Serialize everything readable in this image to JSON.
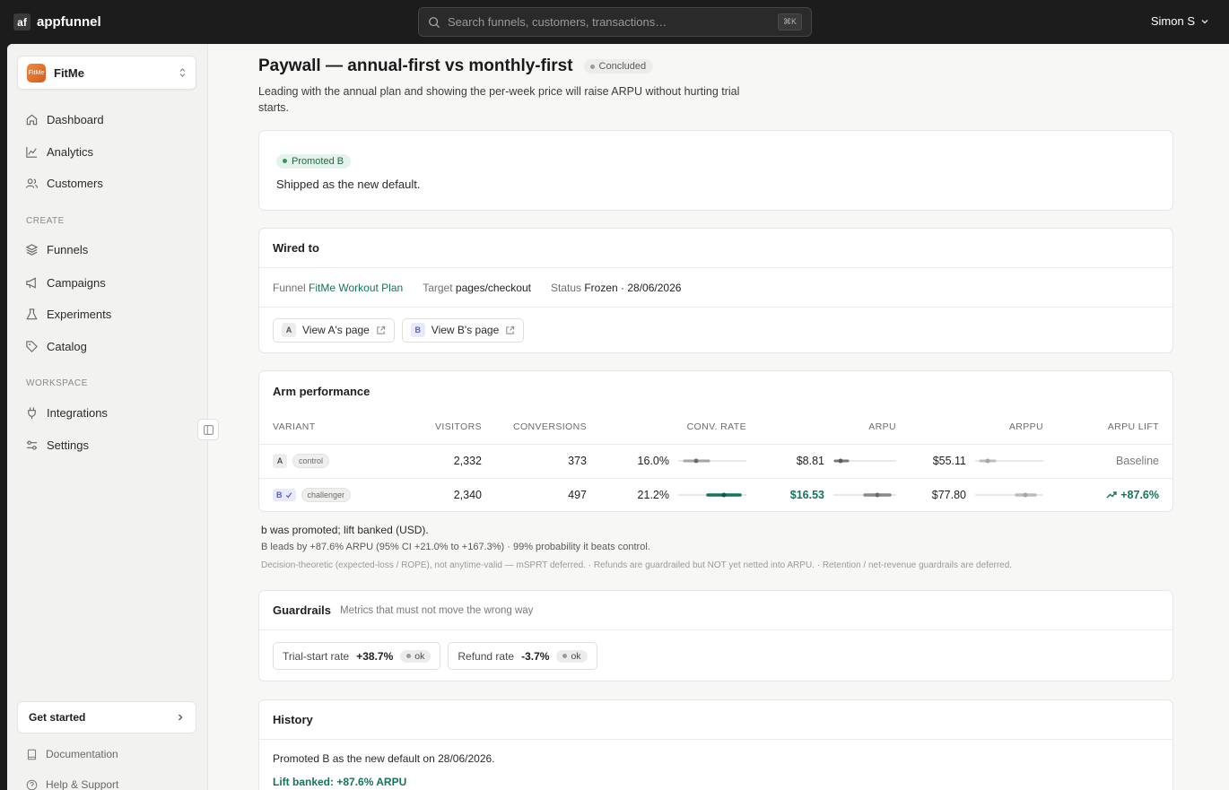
{
  "app": {
    "logo_mark": "af",
    "name": "appfunnel"
  },
  "search": {
    "placeholder": "Search funnels, customers, transactions…",
    "shortcut": "⌘K"
  },
  "user": {
    "name": "Simon S"
  },
  "workspace": {
    "avatar": "FitMe",
    "name": "FitMe"
  },
  "sidebar": {
    "items": [
      {
        "label": "Dashboard",
        "icon": "home-icon"
      },
      {
        "label": "Analytics",
        "icon": "chart-icon"
      },
      {
        "label": "Customers",
        "icon": "users-icon"
      }
    ],
    "create_label": "CREATE",
    "create_items": [
      {
        "label": "Funnels",
        "icon": "layers-icon"
      },
      {
        "label": "Campaigns",
        "icon": "megaphone-icon"
      },
      {
        "label": "Experiments",
        "icon": "flask-icon"
      },
      {
        "label": "Catalog",
        "icon": "tag-icon"
      }
    ],
    "workspace_label": "WORKSPACE",
    "workspace_items": [
      {
        "label": "Integrations",
        "icon": "plug-icon"
      },
      {
        "label": "Settings",
        "icon": "sliders-icon"
      }
    ],
    "get_started": "Get started",
    "documentation": "Documentation",
    "help": "Help & Support"
  },
  "experiment": {
    "title": "Paywall — annual-first vs monthly-first",
    "status": "Concluded",
    "hypothesis": "Leading with the annual plan and showing the per-week price will raise ARPU without hurting trial starts."
  },
  "decision": {
    "badge": "Promoted B",
    "text": "Shipped as the new default."
  },
  "wired": {
    "title": "Wired to",
    "funnel_label": "Funnel",
    "funnel_value": "FitMe Workout Plan",
    "target_label": "Target",
    "target_value": "pages/checkout",
    "status_label": "Status",
    "status_value": "Frozen · 28/06/2026",
    "view_a_chip": "A",
    "view_a": "View A's page",
    "view_b_chip": "B",
    "view_b": "View B's page"
  },
  "performance": {
    "title": "Arm performance",
    "headers": {
      "variant": "VARIANT",
      "visitors": "VISITORS",
      "conversions": "CONVERSIONS",
      "conv_rate": "CONV. RATE",
      "arpu": "ARPU",
      "arppu": "ARPPU",
      "arpu_lift": "ARPU LIFT"
    },
    "rows": [
      {
        "variant": "A",
        "tag": "control",
        "visitors": "2,332",
        "conversions": "373",
        "conv_rate": "16.0%",
        "arpu": "$8.81",
        "arppu": "$55.11",
        "lift": "Baseline"
      },
      {
        "variant": "B",
        "tag": "challenger",
        "visitors": "2,340",
        "conversions": "497",
        "conv_rate": "21.2%",
        "arpu": "$16.53",
        "arppu": "$77.80",
        "lift": "+87.6%"
      }
    ]
  },
  "notes": {
    "line1": "b was promoted; lift banked (USD).",
    "line2": "B leads by +87.6% ARPU (95% CI +21.0% to +167.3%) · 99% probability it beats control.",
    "line3": "Decision-theoretic (expected-loss / ROPE), not anytime-valid — mSPRT deferred. · Refunds are guardrailed but NOT yet netted into ARPU. · Retention / net-revenue guardrails are deferred."
  },
  "guardrails": {
    "title": "Guardrails",
    "subtitle": "Metrics that must not move the wrong way",
    "items": [
      {
        "label": "Trial-start rate",
        "value": "+38.7%",
        "status": "ok"
      },
      {
        "label": "Refund rate",
        "value": "-3.7%",
        "status": "ok"
      }
    ]
  },
  "history": {
    "title": "History",
    "line1": "Promoted B as the new default on 28/06/2026.",
    "line2": "Lift banked: +87.6% ARPU"
  }
}
